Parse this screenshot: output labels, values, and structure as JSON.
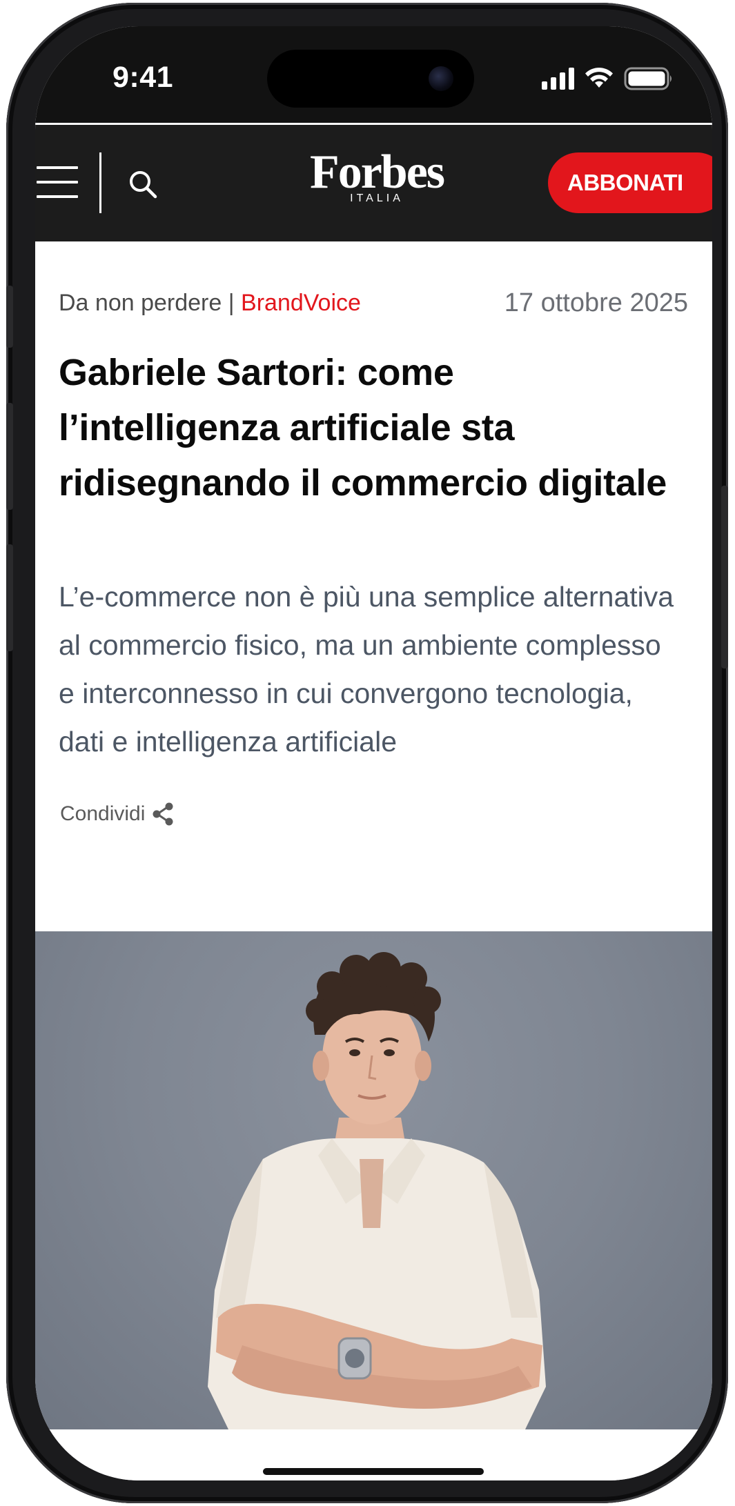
{
  "status_bar": {
    "time": "9:41"
  },
  "header": {
    "logo_word": "Forbes",
    "logo_sub": "ITALIA",
    "subscribe_label": "ABBONATI",
    "accent_color": "#e2161c",
    "background_color": "#1c1c1c"
  },
  "article": {
    "section": "Da non perdere",
    "separator": "|",
    "tag": "BrandVoice",
    "date": "17 ottobre 2025",
    "headline": "Gabriele Sartori: come l’intelligenza artificiale sta ridisegnando il commercio digitale",
    "dek": "L’e-commerce non è più una semplice alternativa al commercio fisico, ma un ambiente complesso e interconnesso in cui convergono tecnologia, dati e intelligenza artificiale",
    "share_label": "Condividi"
  },
  "icons": {
    "menu": "hamburger-menu-icon",
    "search": "search-icon",
    "share": "share-icon",
    "signal": "cellular-signal-icon",
    "wifi": "wifi-icon",
    "battery": "battery-icon"
  }
}
